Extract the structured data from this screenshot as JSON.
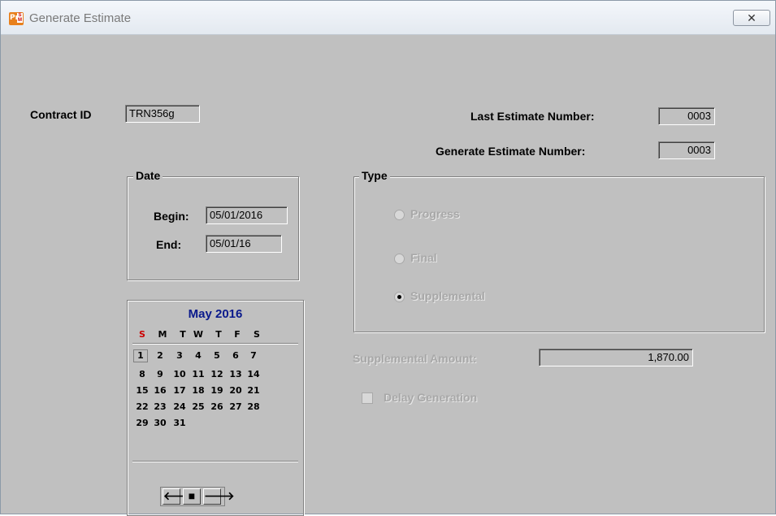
{
  "window": {
    "title": "Generate Estimate",
    "close_glyph": "✕"
  },
  "contract": {
    "label": "Contract ID",
    "value": "TRN356g"
  },
  "last_estimate": {
    "label": "Last Estimate Number:",
    "value": "0003"
  },
  "generate_estimate": {
    "label": "Generate Estimate Number:",
    "value": "0003"
  },
  "date": {
    "legend": "Date",
    "begin_label": "Begin:",
    "begin_value": "05/01/2016",
    "end_label": "End:",
    "end_value": "05/01/16"
  },
  "type": {
    "legend": "Type",
    "options": [
      {
        "label": "Progress",
        "selected": false
      },
      {
        "label": "Final",
        "selected": false
      },
      {
        "label": "Supplemental",
        "selected": true
      }
    ]
  },
  "supplemental_amount": {
    "label": "Supplemental Amount:",
    "value": "1,870.00"
  },
  "delay_generation": {
    "label": "Delay Generation",
    "checked": false
  },
  "calendar": {
    "month_title": "May 2016",
    "days_of_week": [
      "S",
      "M",
      "T",
      "W",
      "T",
      "F",
      "S"
    ],
    "weeks": [
      [
        "1",
        "2",
        "3",
        "4",
        "5",
        "6",
        "7"
      ],
      [
        "8",
        "9",
        "10",
        "11",
        "12",
        "13",
        "14"
      ],
      [
        "15",
        "16",
        "17",
        "18",
        "19",
        "20",
        "21"
      ],
      [
        "22",
        "23",
        "24",
        "25",
        "26",
        "27",
        "28"
      ],
      [
        "29",
        "30",
        "31",
        "",
        "",
        "",
        ""
      ]
    ],
    "selected_day": "1",
    "nav": {
      "prev": "🡐",
      "today": "■",
      "next": "🡒"
    }
  },
  "colors": {
    "background": "#c0c0c0",
    "month_title": "#0a1a8c",
    "sunday": "#cc0000",
    "disabled_text": "#a8a8a8"
  }
}
